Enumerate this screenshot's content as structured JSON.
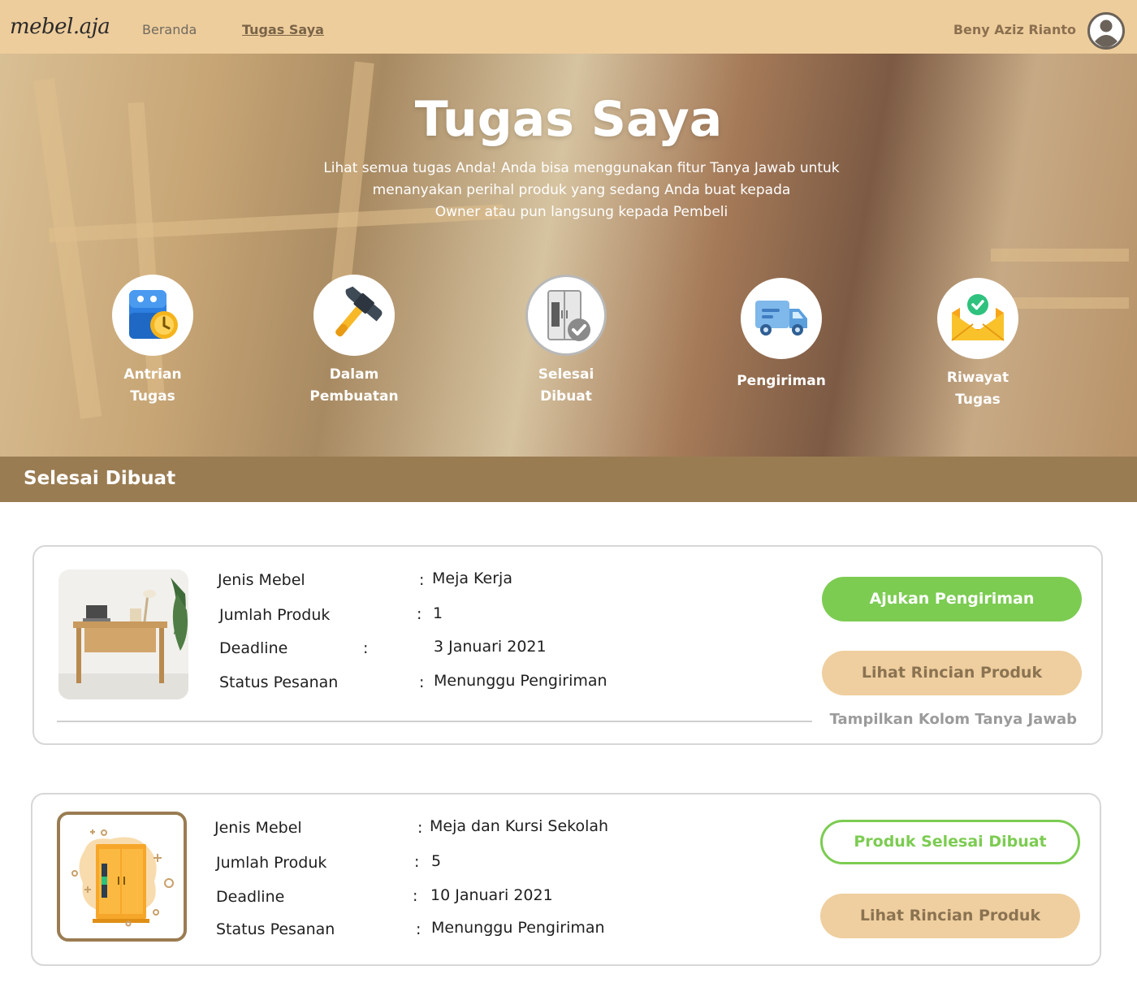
{
  "nav": {
    "logo": "mebel.aja",
    "links": [
      {
        "label": "Beranda",
        "active": false
      },
      {
        "label": "Tugas Saya",
        "active": true
      }
    ],
    "user_name": "Beny Aziz Rianto"
  },
  "hero": {
    "title": "Tugas Saya",
    "subtitle_lines": [
      "Lihat semua tugas Anda! Anda bisa menggunakan fitur Tanya Jawab untuk",
      "menanyakan perihal produk yang sedang Anda buat kepada",
      "Owner atau pun langsung kepada Pembeli"
    ],
    "categories": [
      {
        "label_lines": [
          "Antrian",
          "Tugas"
        ],
        "icon": "calendar-clock-icon",
        "selected": false
      },
      {
        "label_lines": [
          "Dalam",
          "Pembuatan"
        ],
        "icon": "hammer-icon",
        "selected": false
      },
      {
        "label_lines": [
          "Selesai",
          "Dibuat"
        ],
        "icon": "wardrobe-check-icon",
        "selected": true
      },
      {
        "label_lines": [
          "Pengiriman"
        ],
        "icon": "truck-icon",
        "selected": false
      },
      {
        "label_lines": [
          "Riwayat",
          "Tugas"
        ],
        "icon": "envelope-check-icon",
        "selected": false
      }
    ]
  },
  "section": {
    "title": "Selesai Dibuat"
  },
  "field_labels": {
    "jenis": "Jenis Mebel",
    "jumlah": "Jumlah Produk",
    "deadline": "Deadline",
    "status": "Status Pesanan",
    "colon": ":"
  },
  "cards": [
    {
      "jenis": "Meja Kerja",
      "jumlah": "1",
      "deadline": "3 Januari 2021",
      "status": "Menunggu Pengiriman",
      "primary_button": "Ajukan Pengiriman",
      "secondary_button": "Lihat Rincian Produk",
      "qa_link": "Tampilkan Kolom Tanya Jawab",
      "image_icon": "desk-photo"
    },
    {
      "jenis": "Meja dan Kursi Sekolah",
      "jumlah": "5",
      "deadline": "10 Januari 2021",
      "status": "Menunggu Pengiriman",
      "primary_button": "Produk Selesai Dibuat",
      "secondary_button": "Lihat Rincian Produk",
      "image_icon": "wardrobe-illustration"
    }
  ],
  "colors": {
    "nav_bg": "#eecd9c",
    "section_bar": "#9a7c52",
    "green": "#7ccc52",
    "tan_button": "#efcf9f"
  }
}
